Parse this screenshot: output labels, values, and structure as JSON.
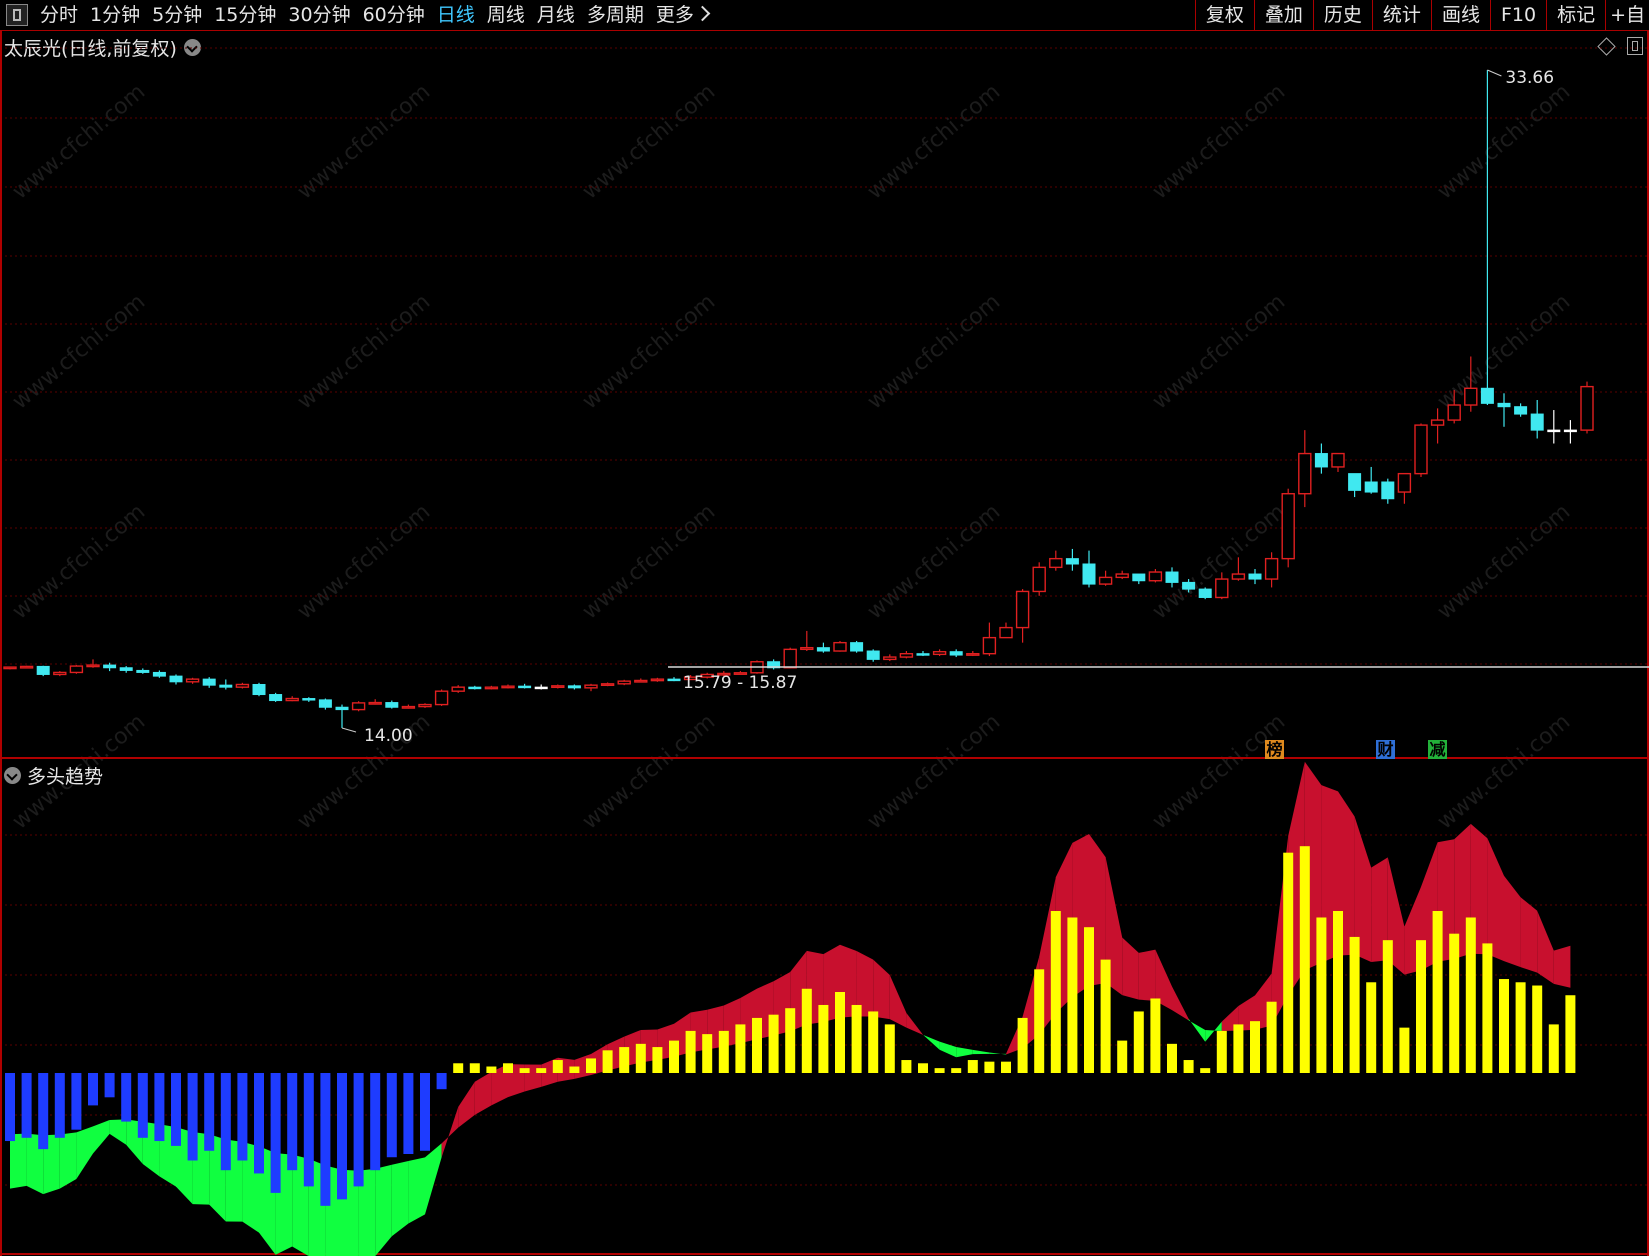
{
  "toolbar": {
    "periods": [
      "分时",
      "1分钟",
      "5分钟",
      "15分钟",
      "30分钟",
      "60分钟",
      "日线",
      "周线",
      "月线",
      "多周期",
      "更多"
    ],
    "active_period": "日线",
    "right_buttons": [
      "复权",
      "叠加",
      "历史",
      "统计",
      "画线",
      "F10",
      "标记",
      "+自"
    ]
  },
  "stock_title": "太辰光(日线,前复权)",
  "indicator_title": "多头趋势",
  "watermark": "www.cfchi.com",
  "badges": [
    {
      "label": "榜",
      "color": "#e08a1e"
    },
    {
      "label": "财",
      "color": "#2f6fd6"
    },
    {
      "label": "减",
      "color": "#23b23a"
    }
  ],
  "chart_data": [
    {
      "type": "candlestick",
      "title": "太辰光(日线,前复权)",
      "annotations": {
        "high_label": "33.66",
        "low_label": "14.00",
        "range_label": "15.79 - 15.87"
      },
      "colors": {
        "up": "#e02020",
        "down": "#40e8f0",
        "flat": "#ffffff"
      },
      "candles": [
        [
          15.8,
          15.82,
          15.75,
          15.83
        ],
        [
          15.82,
          15.84,
          15.78,
          15.86
        ],
        [
          15.84,
          15.6,
          15.55,
          15.86
        ],
        [
          15.6,
          15.66,
          15.55,
          15.7
        ],
        [
          15.66,
          15.85,
          15.62,
          15.88
        ],
        [
          15.85,
          15.88,
          15.8,
          16.05
        ],
        [
          15.88,
          15.8,
          15.7,
          15.95
        ],
        [
          15.8,
          15.72,
          15.65,
          15.85
        ],
        [
          15.72,
          15.66,
          15.62,
          15.78
        ],
        [
          15.66,
          15.55,
          15.5,
          15.72
        ],
        [
          15.55,
          15.38,
          15.3,
          15.6
        ],
        [
          15.38,
          15.46,
          15.32,
          15.5
        ],
        [
          15.46,
          15.28,
          15.2,
          15.52
        ],
        [
          15.28,
          15.22,
          15.15,
          15.45
        ],
        [
          15.22,
          15.3,
          15.18,
          15.35
        ],
        [
          15.3,
          15.0,
          14.95,
          15.35
        ],
        [
          15.0,
          14.82,
          14.78,
          15.05
        ],
        [
          14.82,
          14.88,
          14.8,
          14.95
        ],
        [
          14.88,
          14.84,
          14.78,
          14.92
        ],
        [
          14.84,
          14.62,
          14.55,
          14.88
        ],
        [
          14.62,
          14.55,
          14.0,
          14.7
        ],
        [
          14.55,
          14.75,
          14.5,
          14.8
        ],
        [
          14.75,
          14.76,
          14.7,
          14.86
        ],
        [
          14.76,
          14.62,
          14.58,
          14.82
        ],
        [
          14.62,
          14.64,
          14.58,
          14.7
        ],
        [
          14.64,
          14.7,
          14.6,
          14.74
        ],
        [
          14.7,
          15.1,
          14.66,
          15.15
        ],
        [
          15.1,
          15.22,
          15.05,
          15.28
        ],
        [
          15.22,
          15.2,
          15.15,
          15.26
        ],
        [
          15.2,
          15.22,
          15.15,
          15.26
        ],
        [
          15.22,
          15.25,
          15.18,
          15.3
        ],
        [
          15.25,
          15.22,
          15.18,
          15.32
        ],
        [
          15.22,
          15.22,
          15.15,
          15.3
        ],
        [
          15.22,
          15.26,
          15.18,
          15.3
        ],
        [
          15.26,
          15.2,
          15.15,
          15.3
        ],
        [
          15.2,
          15.28,
          15.1,
          15.32
        ],
        [
          15.28,
          15.32,
          15.25,
          15.36
        ],
        [
          15.32,
          15.4,
          15.28,
          15.44
        ],
        [
          15.4,
          15.42,
          15.36,
          15.48
        ],
        [
          15.42,
          15.46,
          15.38,
          15.5
        ],
        [
          15.46,
          15.45,
          15.4,
          15.52
        ],
        [
          15.45,
          15.52,
          15.45,
          15.58
        ],
        [
          15.52,
          15.6,
          15.48,
          15.65
        ],
        [
          15.6,
          15.63,
          15.55,
          15.7
        ],
        [
          15.63,
          15.65,
          15.6,
          15.7
        ],
        [
          15.65,
          15.98,
          15.62,
          16.02
        ],
        [
          15.98,
          15.8,
          15.75,
          16.05
        ],
        [
          15.8,
          16.35,
          15.78,
          16.4
        ],
        [
          16.35,
          16.4,
          16.3,
          16.9
        ],
        [
          16.4,
          16.3,
          16.25,
          16.55
        ],
        [
          16.3,
          16.55,
          16.28,
          16.6
        ],
        [
          16.55,
          16.3,
          16.25,
          16.6
        ],
        [
          16.3,
          16.05,
          15.98,
          16.35
        ],
        [
          16.05,
          16.12,
          16.0,
          16.2
        ],
        [
          16.12,
          16.22,
          16.08,
          16.3
        ],
        [
          16.22,
          16.2,
          16.15,
          16.3
        ],
        [
          16.2,
          16.28,
          16.15,
          16.35
        ],
        [
          16.28,
          16.18,
          16.12,
          16.35
        ],
        [
          16.18,
          16.22,
          16.15,
          16.3
        ],
        [
          16.22,
          16.7,
          16.15,
          17.15
        ],
        [
          16.7,
          17.0,
          16.7,
          17.15
        ],
        [
          17.0,
          18.08,
          16.55,
          18.15
        ],
        [
          18.08,
          18.8,
          17.95,
          18.95
        ],
        [
          18.8,
          19.06,
          18.7,
          19.3
        ],
        [
          19.06,
          18.9,
          18.7,
          19.35
        ],
        [
          18.9,
          18.3,
          18.2,
          19.3
        ],
        [
          18.3,
          18.5,
          18.25,
          18.7
        ],
        [
          18.5,
          18.6,
          18.45,
          18.7
        ],
        [
          18.6,
          18.4,
          18.3,
          18.55
        ],
        [
          18.4,
          18.66,
          18.35,
          18.75
        ],
        [
          18.66,
          18.35,
          18.2,
          18.8
        ],
        [
          18.35,
          18.15,
          18.05,
          18.45
        ],
        [
          18.15,
          17.9,
          17.85,
          18.2
        ],
        [
          17.9,
          18.45,
          17.85,
          18.65
        ],
        [
          18.45,
          18.6,
          18.4,
          19.1
        ],
        [
          18.6,
          18.45,
          18.3,
          18.75
        ],
        [
          18.45,
          19.06,
          18.2,
          19.25
        ],
        [
          19.06,
          21.0,
          18.8,
          21.15
        ],
        [
          21.0,
          22.2,
          20.6,
          22.9
        ],
        [
          22.2,
          21.8,
          21.6,
          22.5
        ],
        [
          21.8,
          22.2,
          21.65,
          22.2
        ],
        [
          21.6,
          21.1,
          20.9,
          21.6
        ],
        [
          21.35,
          21.05,
          21.0,
          21.8
        ],
        [
          21.35,
          20.85,
          20.7,
          21.45
        ],
        [
          21.05,
          21.6,
          20.7,
          21.6
        ],
        [
          21.6,
          23.05,
          21.5,
          23.1
        ],
        [
          23.05,
          23.2,
          22.5,
          23.55
        ],
        [
          23.2,
          23.65,
          23.1,
          24.1
        ],
        [
          23.65,
          24.15,
          23.45,
          25.1
        ],
        [
          24.15,
          23.7,
          23.65,
          33.66
        ],
        [
          23.7,
          23.6,
          23.0,
          24.0
        ],
        [
          23.6,
          23.38,
          23.3,
          23.7
        ],
        [
          23.38,
          22.9,
          22.65,
          23.8
        ],
        [
          22.9,
          22.9,
          22.5,
          23.5
        ],
        [
          22.9,
          22.9,
          22.5,
          23.2
        ],
        [
          22.9,
          24.2,
          22.8,
          24.35
        ]
      ]
    },
    {
      "type": "bar",
      "title": "多头趋势",
      "series": [
        {
          "values": [
            -0.42,
            -0.4,
            -0.47,
            -0.4,
            -0.35,
            -0.2,
            -0.15,
            -0.3,
            -0.4,
            -0.42,
            -0.45,
            -0.54,
            -0.48,
            -0.6,
            -0.54,
            -0.62,
            -0.74,
            -0.6,
            -0.7,
            -0.82,
            -0.78,
            -0.7,
            -0.6,
            -0.52,
            -0.5,
            -0.48,
            -0.1,
            0.06,
            0.06,
            0.04,
            0.06,
            0.03,
            0.03,
            0.08,
            0.04,
            0.09,
            0.14,
            0.16,
            0.18,
            0.16,
            0.2,
            0.26,
            0.24,
            0.26,
            0.3,
            0.34,
            0.36,
            0.4,
            0.52,
            0.42,
            0.5,
            0.42,
            0.38,
            0.3,
            0.08,
            0.06,
            0.03,
            0.03,
            0.08,
            0.07,
            0.07,
            0.34,
            0.64,
            1.0,
            0.96,
            0.9,
            0.7,
            0.2,
            0.38,
            0.46,
            0.18,
            0.08,
            0.03,
            0.26,
            0.3,
            0.32,
            0.44,
            1.36,
            1.4,
            0.96,
            1.0,
            0.84,
            0.56,
            0.82,
            0.28,
            0.82,
            1.0,
            0.86,
            0.96,
            0.8,
            0.58,
            0.56,
            0.54,
            0.3,
            0.48
          ]
        }
      ],
      "colors": {
        "positive": "#ffff00",
        "negative": "#1e3cff",
        "bull_area": "#c8102e",
        "bear_area": "#10ff40"
      }
    }
  ]
}
